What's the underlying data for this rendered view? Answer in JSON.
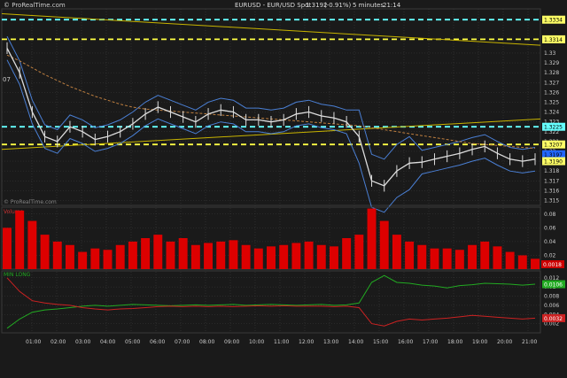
{
  "header": {
    "watermark_left": "© ProRealTime.com",
    "title": "EURUSD - EUR/USD Spot",
    "last_price": "1.3192",
    "change": "(-0.91%)",
    "timeframe": "5 minutes",
    "clock": "21:14"
  },
  "watermark_bottom": "© ProRealTime.com",
  "price_panel": {
    "y_ticks": [
      "1.33",
      "1.329",
      "1.328",
      "1.327",
      "1.326",
      "1.325",
      "1.324",
      "1.323",
      "1.322",
      "1.321",
      "1.32",
      "1.319",
      "1.318",
      "1.317",
      "1.316",
      "1.315"
    ],
    "level_labels": [
      {
        "text": "1.3334",
        "color": "#ffff66"
      },
      {
        "text": "1.3314",
        "color": "#ffff66"
      },
      {
        "text": "1.3225",
        "color": "#66ffff"
      },
      {
        "text": "1.3207",
        "color": "#ffff66"
      },
      {
        "text": "1.3197",
        "color": "#2266ff"
      },
      {
        "text": "1.3190",
        "color": "#ffff66"
      }
    ],
    "left_tag": "07"
  },
  "volume_panel": {
    "label": "Volume",
    "y_ticks": [
      "0.08",
      "0.06",
      "0.04",
      "0.02"
    ],
    "value_label": "0.0018"
  },
  "indicator_panel": {
    "label": "MIN LONG",
    "sublabel": "",
    "y_ticks": [
      "0.012",
      "0.01",
      "0.008",
      "0.006",
      "0.004",
      "0.002"
    ],
    "value_labels": [
      {
        "text": "0.0106",
        "color": "#22aa22"
      },
      {
        "text": "0.0032",
        "color": "#cc2222"
      }
    ]
  },
  "time_axis": [
    "01:00",
    "02:00",
    "03:00",
    "04:00",
    "05:00",
    "06:00",
    "07:00",
    "08:00",
    "09:00",
    "10:00",
    "11:00",
    "12:00",
    "13:00",
    "14:00",
    "15:00",
    "16:00",
    "17:00",
    "18:00",
    "19:00",
    "20:00",
    "21:00"
  ],
  "colors": {
    "background": "#1a1a1a",
    "grid": "#3a3a3a",
    "candles": "#dddddd",
    "bollinger": "#4a7fd4",
    "moving_average": "#c08040",
    "trendline": "#c8b400",
    "volume": "#dd0000",
    "indicator_green": "#22aa22",
    "indicator_red": "#cc2222"
  },
  "chart_data": [
    {
      "type": "line",
      "title": "EURUSD - EUR/USD Spot",
      "timeframe": "5 minutes",
      "y_scale": "price",
      "ylim": [
        1.3145,
        1.3345
      ],
      "x": [
        "00:00",
        "00:30",
        "01:00",
        "01:30",
        "02:00",
        "02:30",
        "03:00",
        "03:30",
        "04:00",
        "04:30",
        "05:00",
        "05:30",
        "06:00",
        "06:30",
        "07:00",
        "07:30",
        "08:00",
        "08:30",
        "09:00",
        "09:30",
        "10:00",
        "10:30",
        "11:00",
        "11:30",
        "12:00",
        "12:30",
        "13:00",
        "13:30",
        "14:00",
        "14:30",
        "15:00",
        "15:30",
        "16:00",
        "16:30",
        "17:00",
        "17:30",
        "18:00",
        "18:30",
        "19:00",
        "19:30",
        "20:00",
        "20:30",
        "21:00"
      ],
      "series": [
        {
          "values": [
            1.3305,
            1.328,
            1.324,
            1.3215,
            1.321,
            1.3225,
            1.322,
            1.3212,
            1.3215,
            1.322,
            1.3228,
            1.3238,
            1.3245,
            1.324,
            1.3235,
            1.323,
            1.3238,
            1.3242,
            1.324,
            1.3232,
            1.3232,
            1.323,
            1.3232,
            1.3238,
            1.324,
            1.3236,
            1.3234,
            1.323,
            1.3215,
            1.317,
            1.3165,
            1.318,
            1.3188,
            1.3189,
            1.3192,
            1.3195,
            1.3198,
            1.3202,
            1.3205,
            1.3198,
            1.3192,
            1.319,
            1.3192
          ]
        },
        {
          "values": [
            1.3298,
            1.3292,
            1.3285,
            1.3278,
            1.3272,
            1.3266,
            1.3261,
            1.3256,
            1.3252,
            1.3248,
            1.3245,
            1.3243,
            1.3242,
            1.3241,
            1.324,
            1.3239,
            1.3238,
            1.3237,
            1.3236,
            1.3235,
            1.3234,
            1.3233,
            1.3232,
            1.3231,
            1.323,
            1.3229,
            1.3228,
            1.3227,
            1.3226,
            1.3224,
            1.3222,
            1.322,
            1.3218,
            1.3216,
            1.3214,
            1.3212,
            1.321,
            1.3208,
            1.3207,
            1.3206,
            1.3205,
            1.3204,
            1.3203
          ]
        }
      ],
      "levels": [
        1.3334,
        1.3314,
        1.3225,
        1.3207,
        1.3197,
        1.319
      ]
    },
    {
      "type": "bar",
      "y_scale": "volume",
      "ylim": [
        0,
        0.09
      ],
      "x": [
        "00:00",
        "00:30",
        "01:00",
        "01:30",
        "02:00",
        "02:30",
        "03:00",
        "03:30",
        "04:00",
        "04:30",
        "05:00",
        "05:30",
        "06:00",
        "06:30",
        "07:00",
        "07:30",
        "08:00",
        "08:30",
        "09:00",
        "09:30",
        "10:00",
        "10:30",
        "11:00",
        "11:30",
        "12:00",
        "12:30",
        "13:00",
        "13:30",
        "14:00",
        "14:30",
        "15:00",
        "15:30",
        "16:00",
        "16:30",
        "17:00",
        "17:30",
        "18:00",
        "18:30",
        "19:00",
        "19:30",
        "20:00",
        "20:30",
        "21:00"
      ],
      "values": [
        0.06,
        0.085,
        0.07,
        0.05,
        0.04,
        0.035,
        0.025,
        0.03,
        0.028,
        0.035,
        0.04,
        0.045,
        0.05,
        0.04,
        0.045,
        0.035,
        0.038,
        0.04,
        0.042,
        0.035,
        0.03,
        0.033,
        0.035,
        0.038,
        0.04,
        0.035,
        0.033,
        0.045,
        0.05,
        0.088,
        0.07,
        0.05,
        0.04,
        0.035,
        0.03,
        0.03,
        0.028,
        0.035,
        0.04,
        0.033,
        0.025,
        0.02,
        0.015
      ]
    },
    {
      "type": "line",
      "title": "MIN LONG",
      "ylim": [
        0,
        0.0135
      ],
      "x": [
        "00:00",
        "00:30",
        "01:00",
        "01:30",
        "02:00",
        "02:30",
        "03:00",
        "03:30",
        "04:00",
        "04:30",
        "05:00",
        "05:30",
        "06:00",
        "06:30",
        "07:00",
        "07:30",
        "08:00",
        "08:30",
        "09:00",
        "09:30",
        "10:00",
        "10:30",
        "11:00",
        "11:30",
        "12:00",
        "12:30",
        "13:00",
        "13:30",
        "14:00",
        "14:30",
        "15:00",
        "15:30",
        "16:00",
        "16:30",
        "17:00",
        "17:30",
        "18:00",
        "18:30",
        "19:00",
        "19:30",
        "20:00",
        "20:30",
        "21:00"
      ],
      "series": [
        {
          "values": [
            0.001,
            0.003,
            0.0045,
            0.005,
            0.0052,
            0.0055,
            0.0058,
            0.006,
            0.0058,
            0.006,
            0.0062,
            0.0061,
            0.006,
            0.0059,
            0.006,
            0.0061,
            0.006,
            0.0061,
            0.0062,
            0.006,
            0.0061,
            0.0062,
            0.0061,
            0.006,
            0.0061,
            0.0062,
            0.006,
            0.0061,
            0.0065,
            0.011,
            0.0125,
            0.011,
            0.0108,
            0.0104,
            0.0102,
            0.0098,
            0.0103,
            0.0105,
            0.0108,
            0.0107,
            0.0106,
            0.0104,
            0.0106
          ]
        },
        {
          "values": [
            0.012,
            0.009,
            0.007,
            0.0065,
            0.0062,
            0.006,
            0.0055,
            0.0052,
            0.005,
            0.0052,
            0.0053,
            0.0055,
            0.0057,
            0.0058,
            0.0057,
            0.0058,
            0.0057,
            0.0058,
            0.0057,
            0.0058,
            0.0059,
            0.0058,
            0.0059,
            0.0058,
            0.0058,
            0.0058,
            0.0057,
            0.0058,
            0.0055,
            0.002,
            0.0015,
            0.0025,
            0.003,
            0.0028,
            0.003,
            0.0032,
            0.0035,
            0.0038,
            0.0036,
            0.0034,
            0.0032,
            0.003,
            0.0032
          ]
        }
      ]
    }
  ]
}
